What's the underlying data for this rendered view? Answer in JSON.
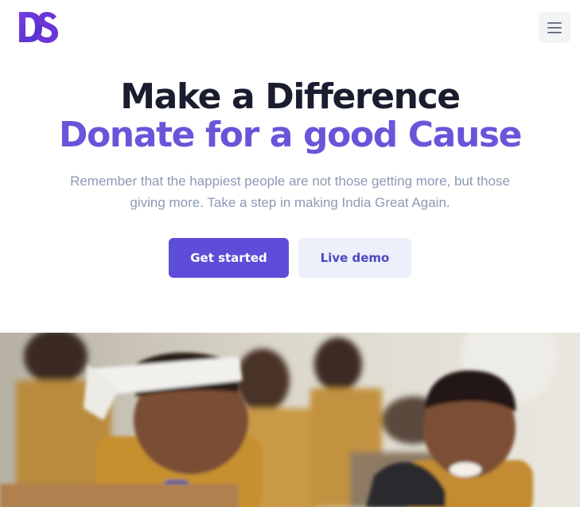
{
  "header": {
    "logo_text": "DS",
    "menu_icon": "hamburger-menu-icon"
  },
  "hero": {
    "title_line1": "Make a Difference",
    "title_line2": "Donate for a good Cause",
    "subtitle": "Remember that the happiest people are not those getting more, but those giving more. Take a step in making India Great Again.",
    "primary_cta": "Get started",
    "secondary_cta": "Live demo"
  },
  "colors": {
    "accent": "#6b54d9",
    "primary_button": "#5d4dd9",
    "secondary_button_bg": "#ebf0fb",
    "heading": "#1a1d2e",
    "body_text": "#8c9ab4"
  }
}
